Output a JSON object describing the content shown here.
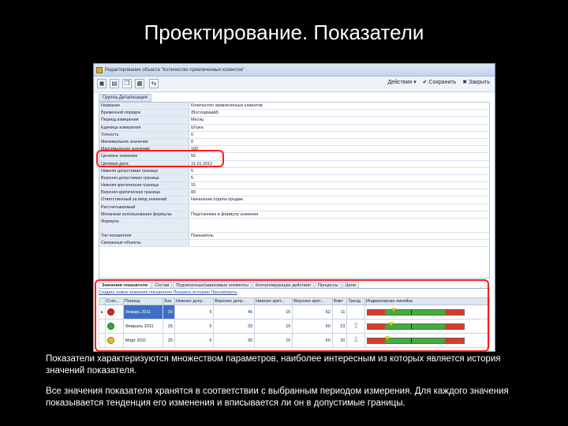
{
  "slide": {
    "title": "Проектирование. Показатели",
    "caption_1": "Показатели характеризуются множеством параметров, наиболее интересным из которых является история значений показателя.",
    "caption_2": "Все значения показателя хранятся в соответствии с выбранным периодом измерения. Для каждого значения показывается тенденция его изменения и вписывается ли он в допустимые границы."
  },
  "window": {
    "title": "Редактирование объекта \"Количество привлеченных клиентов\"",
    "toolbar": {
      "actions_label": "Действия",
      "save_label": "Сохранить",
      "close_label": "Закрыть"
    },
    "detail_tab": "Группа Детализация"
  },
  "form": {
    "rows": [
      {
        "label": "Название",
        "value": "Количество привлеченных клиентов"
      },
      {
        "label": "Временной порядок",
        "value": "(Восходящий)"
      },
      {
        "label": "Период измерения",
        "value": "Месяц"
      },
      {
        "label": "Единица измерения",
        "value": "Штука"
      },
      {
        "label": "Точность",
        "value": "0"
      },
      {
        "label": "Минимальное значение",
        "value": "0"
      },
      {
        "label": "Максимальное значение",
        "value": "100"
      },
      {
        "label": "Целевое значение",
        "value": "55"
      },
      {
        "label": "Целевая дата",
        "value": "31.01.2012"
      },
      {
        "label": "Нижняя допустимая граница",
        "value": "5"
      },
      {
        "label": "Верхняя допустимая граница",
        "value": "5"
      },
      {
        "label": "Нижняя критическая граница",
        "value": "15"
      },
      {
        "label": "Верхняя критическая граница",
        "value": "80"
      },
      {
        "label": "Ответственный за ввод значений",
        "value": "Начальник отдела продаж"
      },
      {
        "label": "Рассчитываемый",
        "value": ""
      },
      {
        "label": "Механизм использования формулы",
        "value": "Подстановка в формулу значения"
      },
      {
        "label": "Формула",
        "value": ""
      },
      {
        "label": "Тип показателя",
        "value": "Показатель"
      },
      {
        "label": "Связанные объекты",
        "value": ""
      }
    ]
  },
  "tabs": [
    "Значения показателя",
    "Состав",
    "Подчиненные/зависимые элементы",
    "Контролирующие действия",
    "Процессы",
    "Цели"
  ],
  "subnav": "Создать новое значение показателя   Показать историю   Просмотреть",
  "grid": {
    "headers": [
      "Стат...",
      "Период",
      "Зна",
      "Нижнее допу...",
      "Верхнее допу...",
      "Нижнее крит...",
      "Верхнее крит...",
      "Факт",
      "Тренд",
      "Индикаторная линейка"
    ],
    "rows": [
      {
        "status": "red",
        "period": "Январь 2011",
        "value": "20",
        "low_ok": "5",
        "high_ok": "45",
        "low_crit": "15",
        "high_crit": "62",
        "fact": "11",
        "trend": "",
        "marker": 0.25
      },
      {
        "status": "green",
        "period": "Февраль 2011",
        "value": "25",
        "low_ok": "5",
        "high_ok": "33",
        "low_crit": "15",
        "high_crit": "60",
        "fact": "23",
        "trend": "up",
        "marker": 0.22
      },
      {
        "status": "yellow",
        "period": "Март 2011",
        "value": "25",
        "low_ok": "5",
        "high_ok": "30",
        "low_crit": "15",
        "high_crit": "50",
        "fact": "20",
        "trend": "down",
        "marker": 0.18
      }
    ]
  },
  "colors": {
    "highlight": "#ff1a1a",
    "selected_row": "#3d6fc2"
  }
}
